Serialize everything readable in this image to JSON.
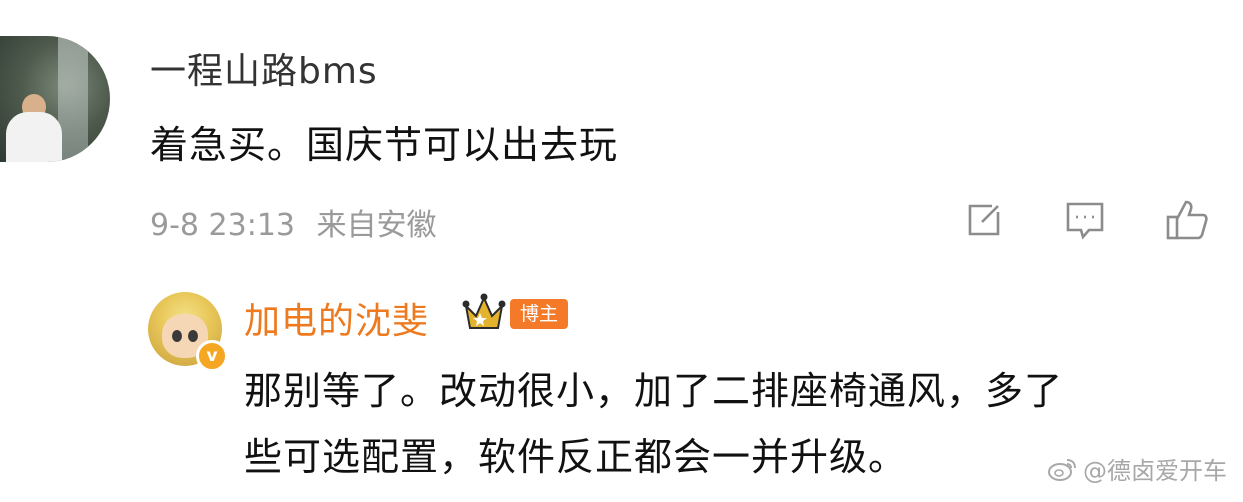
{
  "comment": {
    "username": "一程山路bms",
    "text": "着急买。国庆节可以出去玩",
    "time": "9-8 23:13",
    "location": "来自安徽"
  },
  "actions": {
    "share_icon": "share-edit-icon",
    "reply_icon": "comment-icon",
    "like_icon": "thumbs-up-icon"
  },
  "reply": {
    "username": "加电的沈斐",
    "badge": "博主",
    "verified": "v",
    "text_line1": "那别等了。改动很小，加了二排座椅通风，多了",
    "text_line2": "些可选配置，软件反正都会一并升级。"
  },
  "watermark": "@德卤爱开车",
  "colors": {
    "accent": "#ee7a1f",
    "badge_bg": "#f47a2a",
    "meta_gray": "#9a9a9a"
  }
}
